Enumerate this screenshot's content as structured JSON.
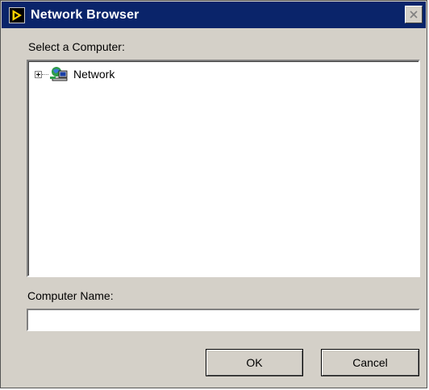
{
  "window": {
    "title": "Network Browser",
    "title_bar_color": "#0a246a",
    "background_color": "#d4d0c8"
  },
  "tree": {
    "label": "Select a Computer:",
    "items": [
      {
        "label": "Network",
        "icon": "network-icon",
        "expanded": false
      }
    ]
  },
  "computer_name": {
    "label": "Computer Name:",
    "value": "",
    "placeholder": ""
  },
  "buttons": {
    "ok": "OK",
    "cancel": "Cancel"
  }
}
